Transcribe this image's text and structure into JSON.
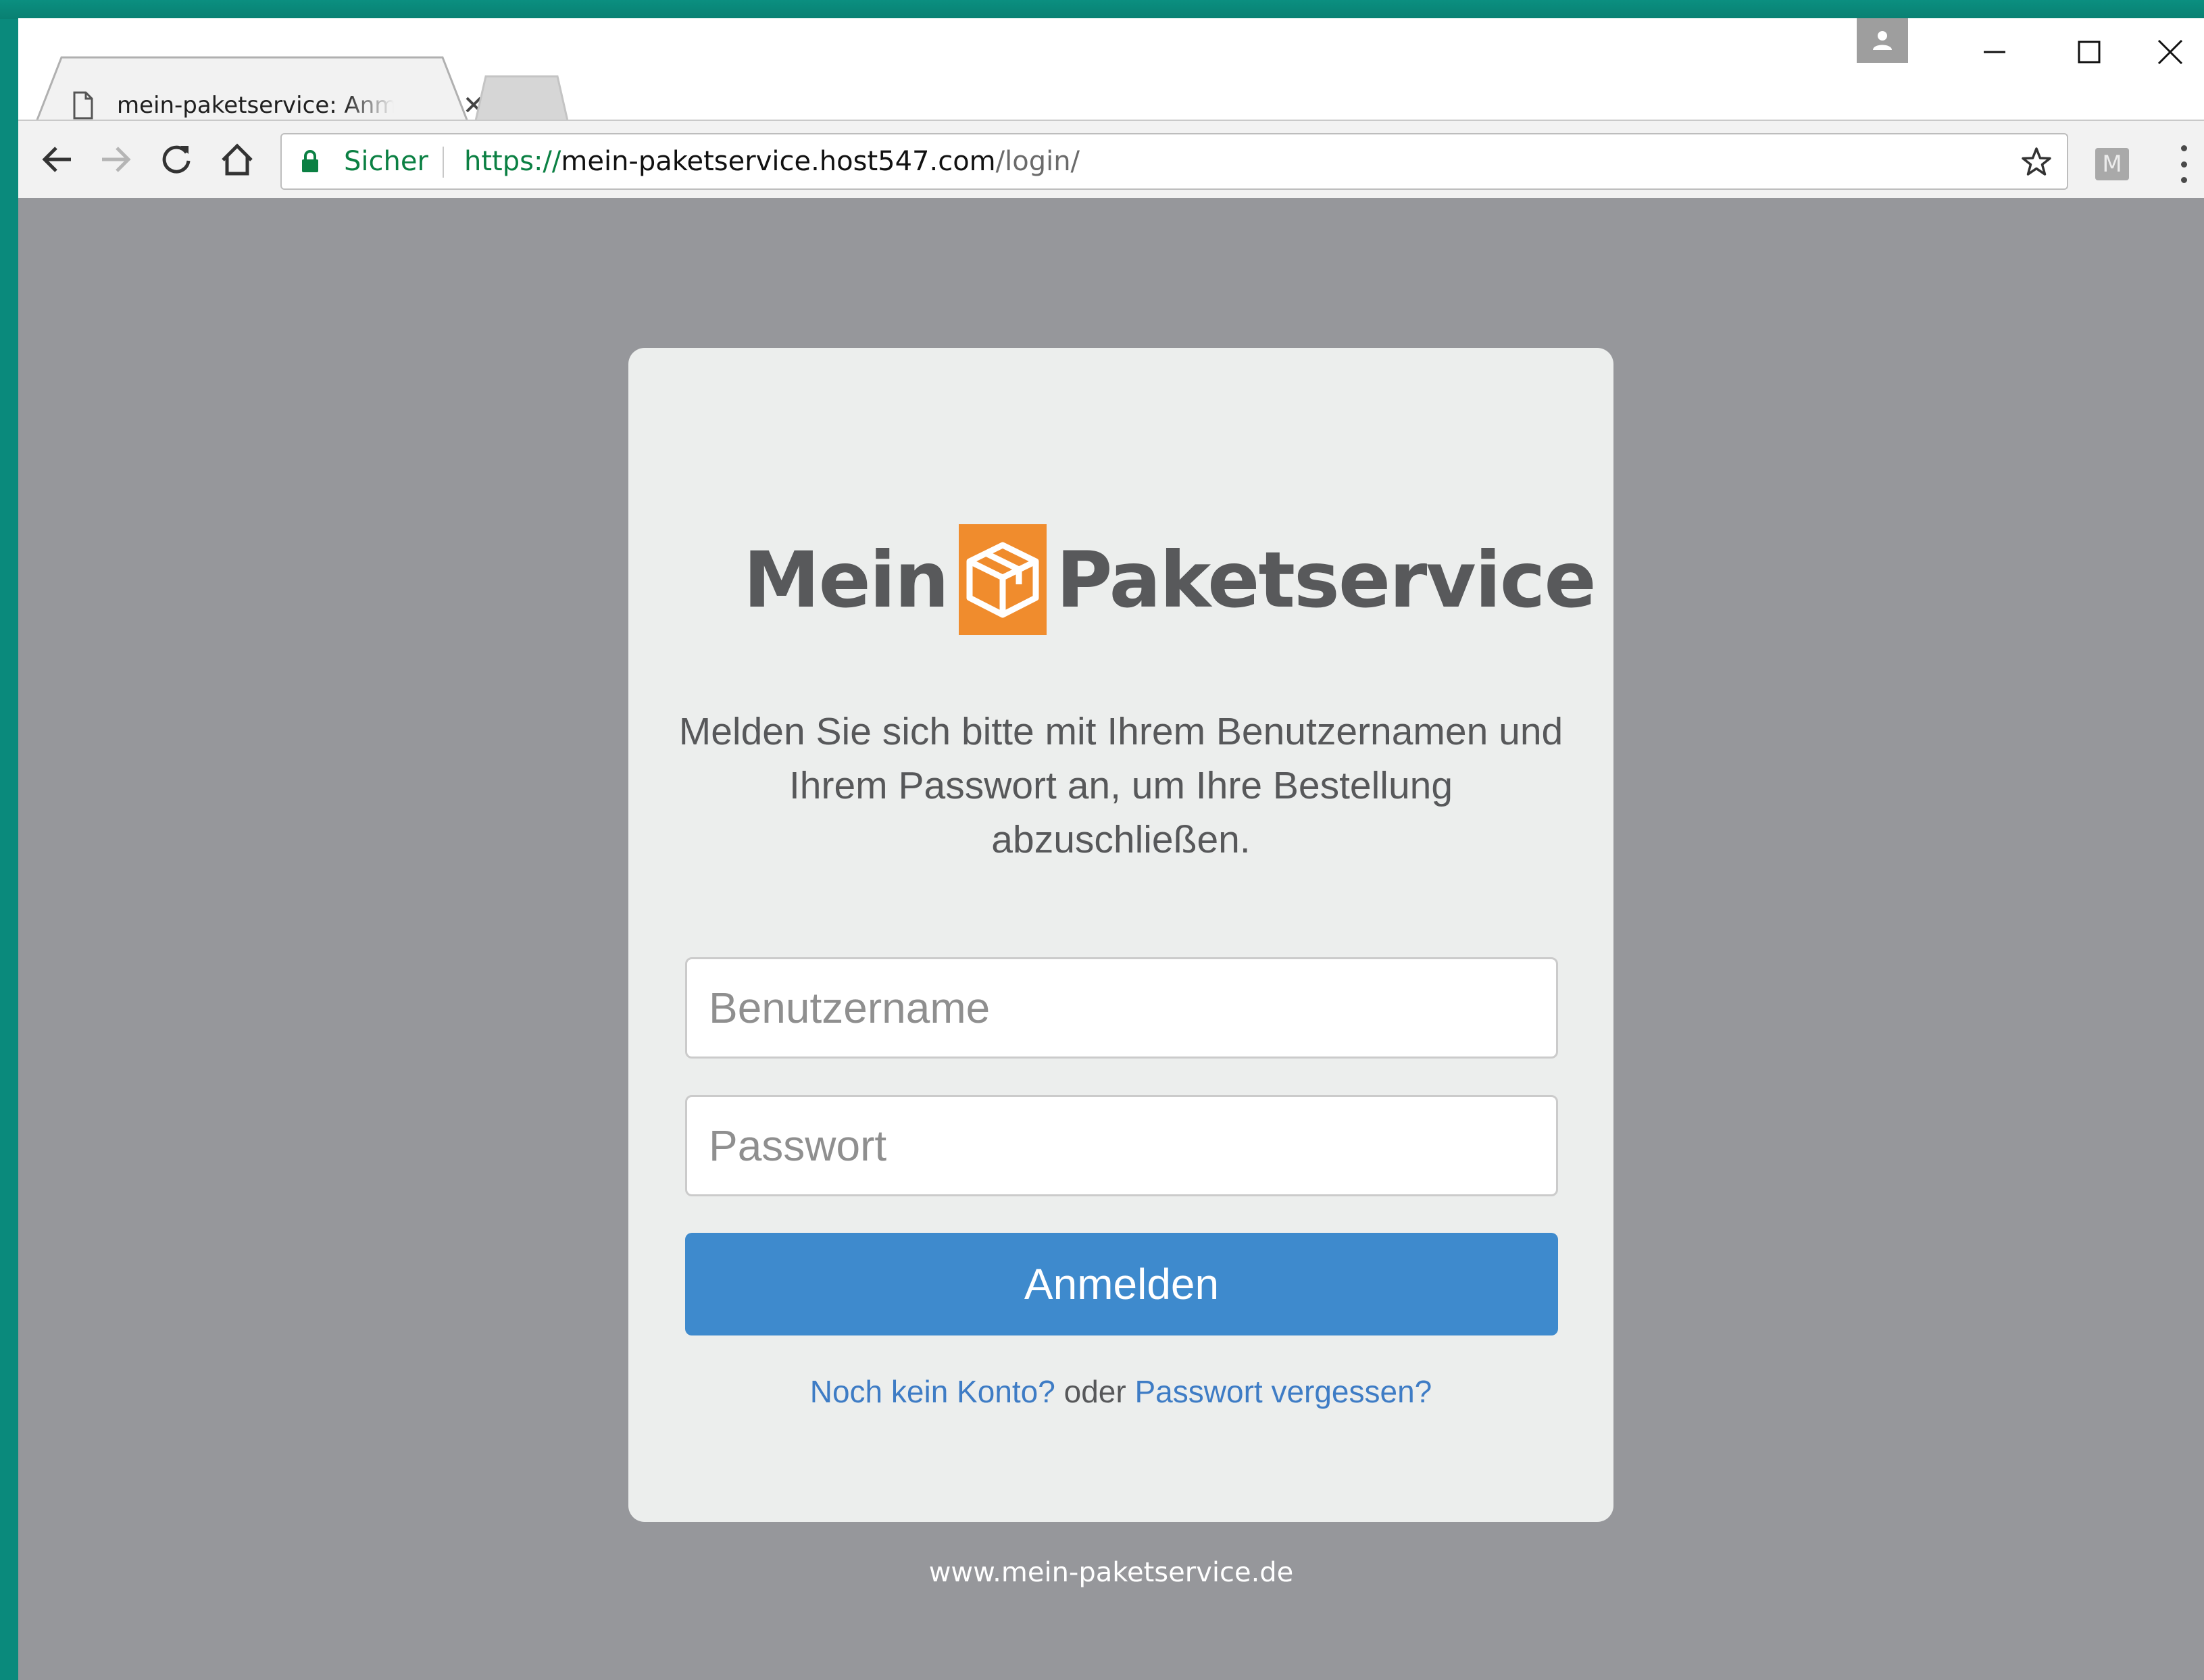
{
  "browser": {
    "tab_title": "mein-paketservice: Anmeldung",
    "close_tab_glyph": "×",
    "extension_label": "M",
    "security_label": "Sicher",
    "url_scheme": "https://",
    "url_host": "mein-paketservice.host547.com",
    "url_path": "/login/"
  },
  "page": {
    "logo_left": "Mein",
    "logo_right": "Paketservice",
    "intro_text": "Melden Sie sich bitte mit Ihrem Benutzernamen und Ihrem Passwort an, um Ihre Bestellung abzuschließen.",
    "username_placeholder": "Benutzername",
    "password_placeholder": "Passwort",
    "login_button": "Anmelden",
    "register_link": "Noch kein Konto?",
    "links_connector": "oder",
    "forgot_link": "Passwort vergessen?",
    "footer_url": "www.mein-paketservice.de"
  },
  "colors": {
    "brand_orange": "#f08c2d",
    "button_blue": "#3e8acd",
    "link_blue": "#3e7cc5",
    "secure_green": "#0b8043",
    "page_background": "#96979b"
  }
}
